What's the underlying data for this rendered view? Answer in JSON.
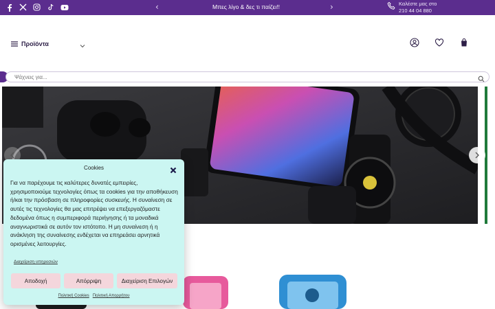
{
  "topbar": {
    "promo_text": "Μπες λίγο & δες τι παίζει!!",
    "contact_line1": "Καλέστε μας στο",
    "contact_line2": "210 44 04 880",
    "accent_color": "#5b2d8e",
    "social_icons": [
      "facebook-icon",
      "x-icon",
      "instagram-icon",
      "tiktok-icon",
      "youtube-icon"
    ]
  },
  "header": {
    "menu_label": "Προϊόντα",
    "icons": [
      "account-icon",
      "wishlist-icon",
      "cart-icon"
    ]
  },
  "search": {
    "placeholder": "Ψάχνεις για..."
  },
  "cookie_modal": {
    "title": "Cookies",
    "body": "Για να παρέχουμε τις καλύτερες δυνατές εμπειρίες, χρησιμοποιούμε τεχνολογίες όπως τα cookies για την αποθήκευση ή/και την πρόσβαση σε πληροφορίες συσκευής. Η συναίνεση σε αυτές τις τεχνολογίες θα μας επιτρέψει να επεξεργαζόμαστε δεδομένα όπως η συμπεριφορά περιήγησης ή τα μοναδικά αναγνωριστικά σε αυτόν τον ιστότοπο. Η μη συναίνεση ή η ανάκληση της συναίνεσης ενδέχεται να επηρεάσει αρνητικά ορισμένες λειτουργίες.",
    "manage_services": "Διαχείριση υπηρεσιών",
    "accept_label": "Αποδοχή",
    "deny_label": "Απόρριψη",
    "manage_label": "Διαχείριση Επιλογών",
    "cookie_policy": "Πολιτική Cookies",
    "privacy_policy": "Πολιτική Απορρήτου",
    "background_color": "#cbf6f2",
    "button_color": "#f4d6dc"
  }
}
